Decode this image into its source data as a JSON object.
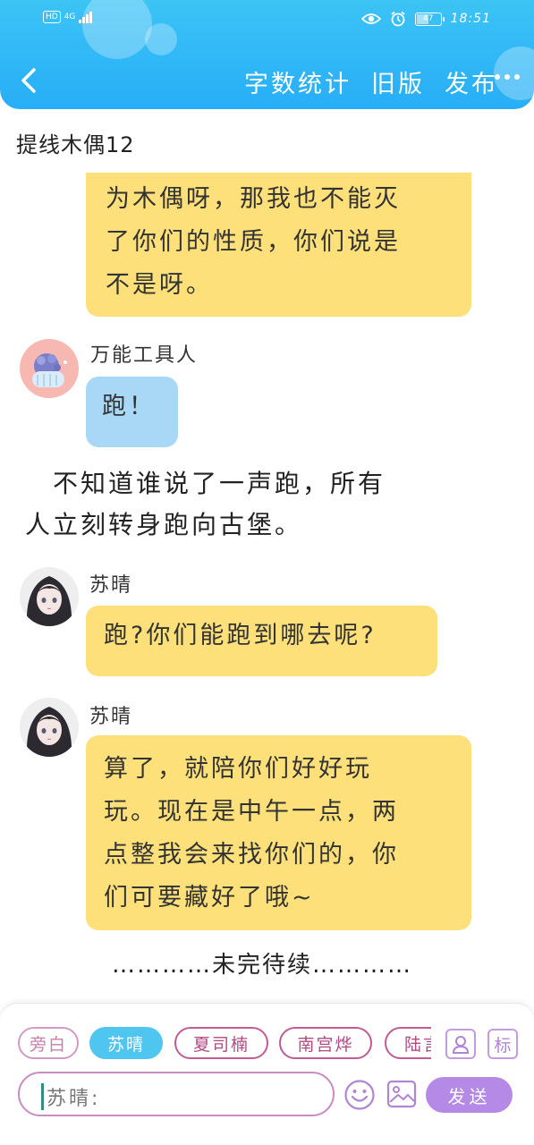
{
  "status_bar": {
    "hd": "HD",
    "network": "4G",
    "battery": "47",
    "battery_level": 0.47,
    "time": "18:51"
  },
  "header": {
    "back_icon": "chevron-left-icon",
    "actions": [
      "字数统计",
      "旧版",
      "发布"
    ],
    "more_icon": "more-dots-icon"
  },
  "story": {
    "title": "提线木偶12"
  },
  "messages": [
    {
      "type": "bubble",
      "color": "#fde07a",
      "lines": [
        "为木偶呀，那我也不能灭",
        "了你们的性质，你们说是",
        "不是呀。"
      ]
    },
    {
      "type": "bubble",
      "speaker": "万能工具人",
      "color": "#a9d8f7",
      "lines": [
        "跑！"
      ]
    },
    {
      "type": "narration",
      "lines": [
        "　不知道谁说了一声跑，所有",
        "人立刻转身跑向古堡。"
      ]
    },
    {
      "type": "bubble",
      "speaker": "苏晴",
      "color": "#fde07a",
      "lines": [
        "跑?你们能跑到哪去呢?"
      ]
    },
    {
      "type": "bubble",
      "speaker": "苏晴",
      "color": "#fde07a",
      "lines": [
        "算了，就陪你们好好玩",
        "玩。现在是中午一点，两",
        "点整我会来找你们的，你",
        "们可要藏好了哦~"
      ]
    }
  ],
  "footer_note": "…………未完待续…………",
  "bottom_panel": {
    "roles": [
      {
        "label": "旁白",
        "active": false
      },
      {
        "label": "苏晴",
        "active": true
      },
      {
        "label": "夏司楠",
        "active": false
      },
      {
        "label": "南宫烨",
        "active": false
      },
      {
        "label": "陆言",
        "active": false
      }
    ],
    "tools": {
      "role_icon": "person-icon",
      "mark_label": "标"
    },
    "input_prefix": "苏晴:",
    "emoji_icon": "smiley-icon",
    "image_icon": "image-icon",
    "send_label": "发送",
    "accent": "#b48ae6",
    "active_chip_color": "#4fc6ef"
  }
}
